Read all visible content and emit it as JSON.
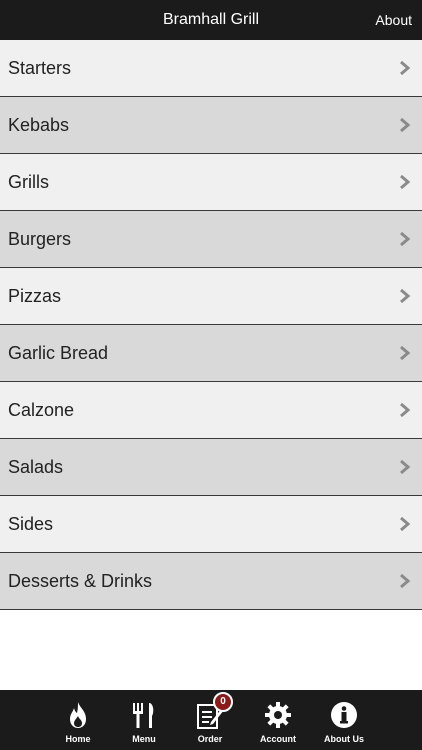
{
  "header": {
    "title": "Bramhall Grill",
    "about_label": "About"
  },
  "menu": {
    "categories": [
      {
        "label": "Starters"
      },
      {
        "label": "Kebabs"
      },
      {
        "label": "Grills"
      },
      {
        "label": "Burgers"
      },
      {
        "label": "Pizzas"
      },
      {
        "label": "Garlic Bread"
      },
      {
        "label": "Calzone"
      },
      {
        "label": "Salads"
      },
      {
        "label": "Sides"
      },
      {
        "label": "Desserts & Drinks"
      }
    ]
  },
  "tabbar": {
    "home_label": "Home",
    "menu_label": "Menu",
    "order_label": "Order",
    "order_badge": "0",
    "account_label": "Account",
    "about_us_label": "About Us"
  },
  "colors": {
    "bar_background": "#1b1b1b",
    "row_light": "#f0f0f0",
    "row_dark": "#d9d9d9",
    "badge": "#8b1a1a"
  }
}
